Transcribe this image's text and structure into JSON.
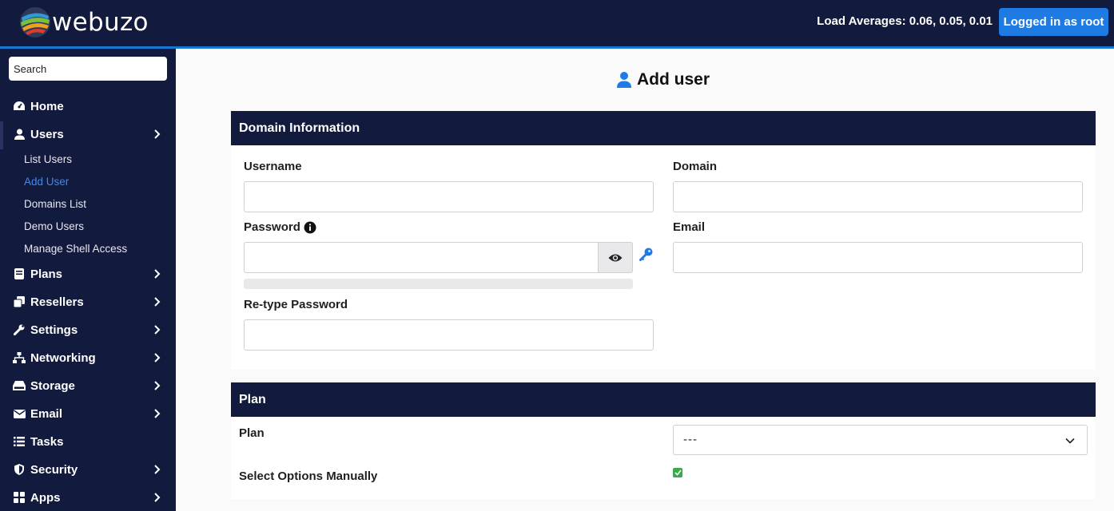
{
  "header": {
    "brand": "webuzo",
    "load_averages": "Load Averages: 0.06, 0.05, 0.01",
    "logged_in": "Logged in as root"
  },
  "sidebar": {
    "search_placeholder": "Search",
    "items": [
      {
        "label": "Home",
        "icon": "dashboard-icon"
      },
      {
        "label": "Users",
        "icon": "user-icon"
      },
      {
        "label": "Plans",
        "icon": "plans-icon"
      },
      {
        "label": "Resellers",
        "icon": "resellers-icon"
      },
      {
        "label": "Settings",
        "icon": "wrench-icon"
      },
      {
        "label": "Networking",
        "icon": "network-icon"
      },
      {
        "label": "Storage",
        "icon": "storage-icon"
      },
      {
        "label": "Email",
        "icon": "envelope-icon"
      },
      {
        "label": "Tasks",
        "icon": "list-icon"
      },
      {
        "label": "Security",
        "icon": "shield-icon"
      },
      {
        "label": "Apps",
        "icon": "apps-icon"
      }
    ],
    "users_sub": [
      {
        "label": "List Users"
      },
      {
        "label": "Add User",
        "active": true
      },
      {
        "label": "Domains List"
      },
      {
        "label": "Demo Users"
      },
      {
        "label": "Manage Shell Access"
      }
    ],
    "active_color": "#3d8bf2"
  },
  "page": {
    "title": "Add user"
  },
  "domain_info": {
    "heading": "Domain Information",
    "username_label": "Username",
    "username_value": "",
    "domain_label": "Domain",
    "domain_value": "",
    "password_label": "Password",
    "password_value": "",
    "email_label": "Email",
    "email_value": "",
    "retype_label": "Re-type Password",
    "retype_value": ""
  },
  "plan": {
    "heading": "Plan",
    "plan_label": "Plan",
    "plan_selected": "---",
    "manual_label": "Select Options Manually",
    "manual_checked": true
  },
  "colors": {
    "header_bg": "#121a3d",
    "accent": "#1e7be3",
    "checkbox": "#3aaa4a"
  }
}
